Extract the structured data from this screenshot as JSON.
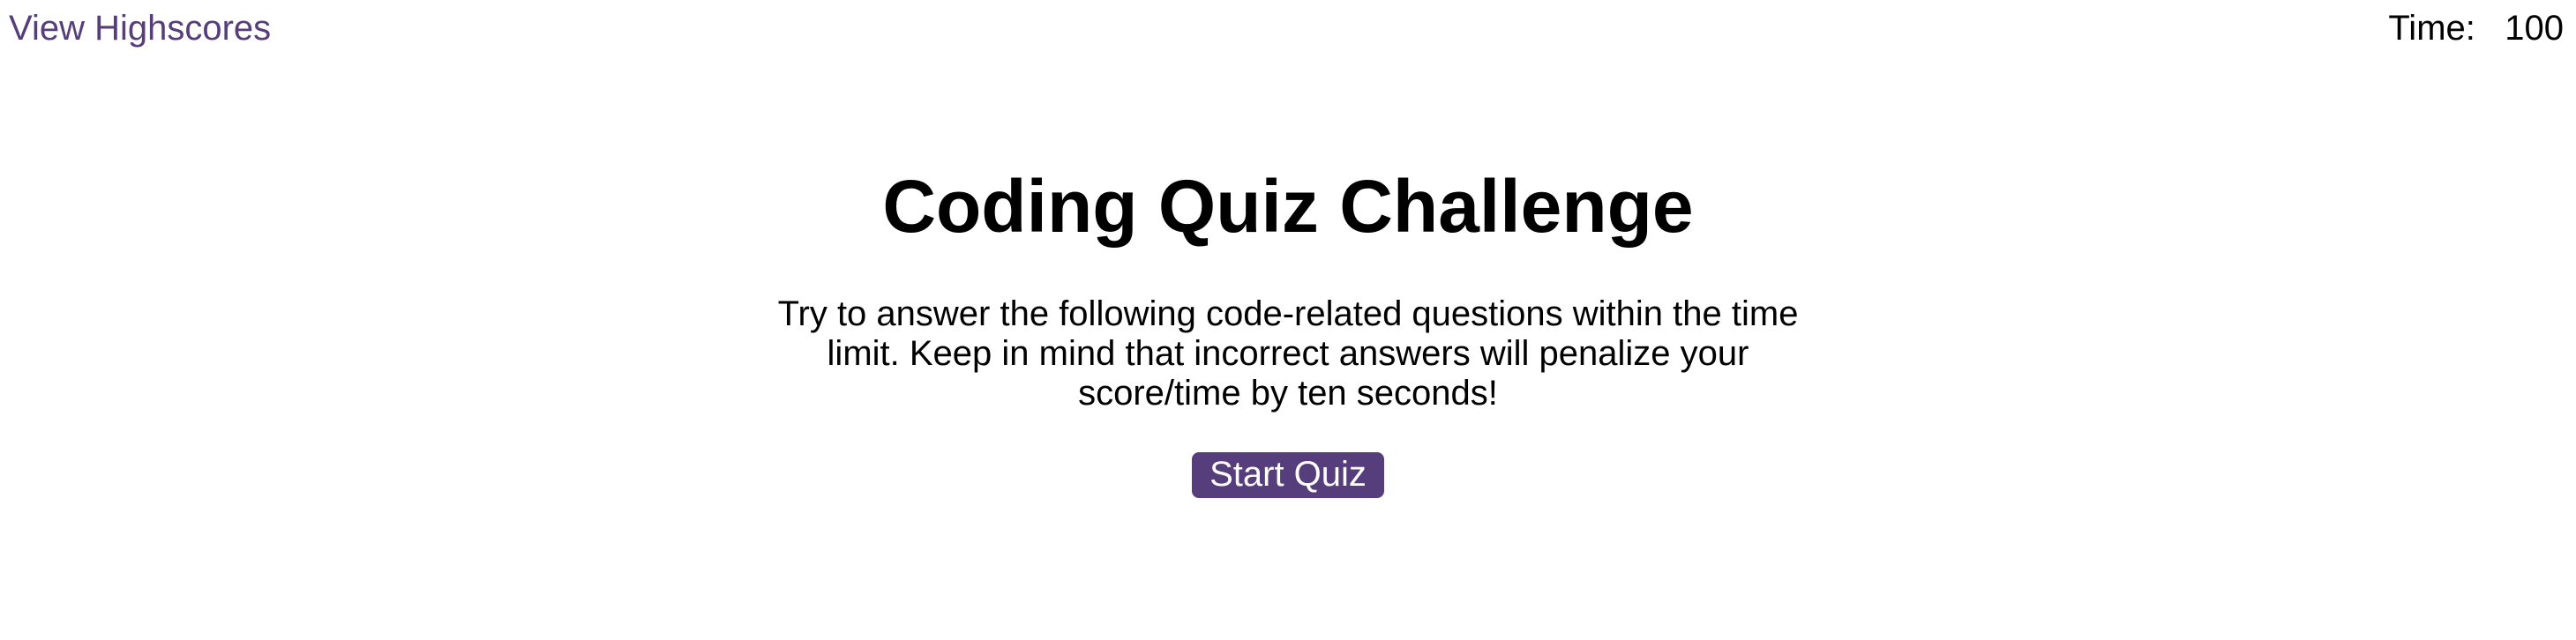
{
  "header": {
    "highscores_label": "View Highscores",
    "timer_label": "Time:",
    "timer_value": "100"
  },
  "main": {
    "title": "Coding Quiz Challenge",
    "intro": "Try to answer the following code-related questions within the time limit. Keep in mind that incorrect answers will penalize your score/time by ten seconds!",
    "start_button_label": "Start Quiz"
  },
  "colors": {
    "accent": "#563d7c",
    "text": "#000000",
    "background": "#ffffff"
  }
}
